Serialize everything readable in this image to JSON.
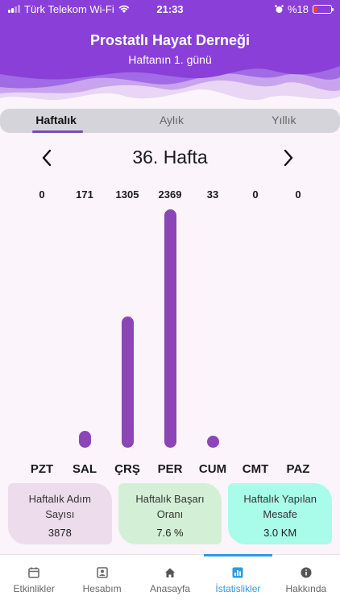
{
  "status_bar": {
    "carrier": "Türk Telekom Wi-Fi",
    "time": "21:33",
    "battery": "%18",
    "battery_level": 0.18
  },
  "header": {
    "title": "Prostatlı Hayat Derneği",
    "subtitle": "Haftanın 1. günü"
  },
  "tabs": [
    {
      "label": "Haftalık",
      "active": true
    },
    {
      "label": "Aylık",
      "active": false
    },
    {
      "label": "Yıllık",
      "active": false
    }
  ],
  "week": {
    "title": "36. Hafta"
  },
  "chart_data": {
    "type": "bar",
    "title": "",
    "xlabel": "",
    "ylabel": "",
    "categories": [
      "PZT",
      "SAL",
      "ÇRŞ",
      "PER",
      "CUM",
      "CMT",
      "PAZ"
    ],
    "values": [
      0,
      171,
      1305,
      2369,
      33,
      0,
      0
    ],
    "value_labels": [
      "0",
      "171",
      "1305",
      "2369",
      "33",
      "0",
      "0"
    ],
    "ylim": [
      0,
      2369
    ],
    "grid": false,
    "bar_color": "#8b45b7"
  },
  "stats": [
    {
      "title": "Haftalık Adım Sayısı",
      "value": "3878",
      "color": "#ecdcec"
    },
    {
      "title": "Haftalık Başarı Oranı",
      "value": "7.6 %",
      "color": "#d3f0d6"
    },
    {
      "title": "Haftalık Yapılan Mesafe",
      "value": "3.0 KM",
      "color": "#a9fbea"
    }
  ],
  "bottom_nav": [
    {
      "label": "Etkinlikler",
      "icon": "calendar-icon",
      "active": false
    },
    {
      "label": "Hesabım",
      "icon": "profile-icon",
      "active": false
    },
    {
      "label": "Anasayfa",
      "icon": "home-icon",
      "active": false
    },
    {
      "label": "İstatislikler",
      "icon": "stats-icon",
      "active": true
    },
    {
      "label": "Hakkında",
      "icon": "info-icon",
      "active": false
    }
  ],
  "colors": {
    "header": "#8a3fd8",
    "accent": "#2f9be0",
    "bar": "#8b45b7"
  }
}
